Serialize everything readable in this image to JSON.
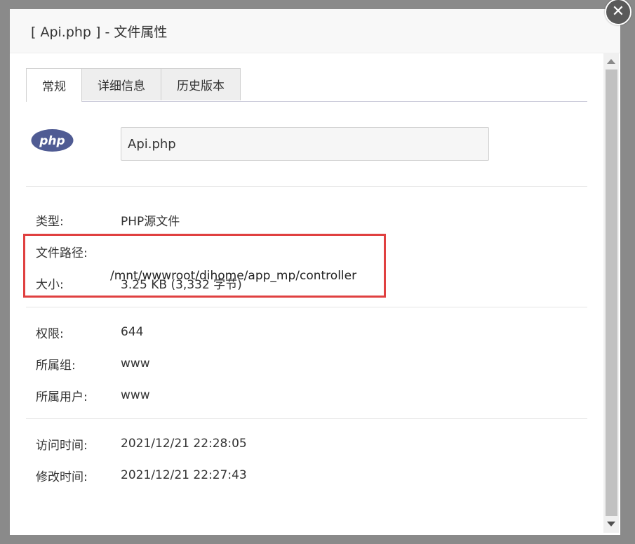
{
  "dialog": {
    "title": "[ Api.php ] - 文件属性"
  },
  "tabs": [
    {
      "label": "常规",
      "active": true
    },
    {
      "label": "详细信息",
      "active": false
    },
    {
      "label": "历史版本",
      "active": false
    }
  ],
  "file": {
    "icon": "php-file-icon",
    "name": "Api.php"
  },
  "properties": {
    "type": {
      "label": "类型:",
      "value": "PHP源文件"
    },
    "path": {
      "label": "文件路径:",
      "value": "/mnt/wwwroot/dihome/app_mp/controller"
    },
    "size": {
      "label": "大小:",
      "value": "3.25 KB (3,332 字节)"
    },
    "permission": {
      "label": "权限:",
      "value": "644"
    },
    "group": {
      "label": "所属组:",
      "value": "www"
    },
    "owner": {
      "label": "所属用户:",
      "value": "www"
    },
    "accessed": {
      "label": "访问时间:",
      "value": "2021/12/21 22:28:05"
    },
    "modified": {
      "label": "修改时间:",
      "value": "2021/12/21 22:27:43"
    }
  },
  "colors": {
    "highlight_border": "#e04040",
    "php_logo": "#4f5b93"
  }
}
